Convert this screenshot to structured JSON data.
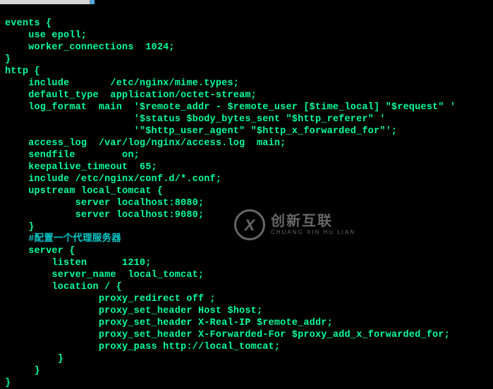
{
  "tab_visible": true,
  "watermark": {
    "icon_letter": "X",
    "line1": "创新互联",
    "line2": "CHUANG XIN HU LIAN"
  },
  "code": {
    "l1": "events {",
    "l2": "    use epoll;",
    "l3": "    worker_connections  1024;",
    "l4": "}",
    "l5": "http {",
    "l6": "    include       /etc/nginx/mime.types;",
    "l7": "    default_type  application/octet-stream;",
    "l8": "    log_format  main  '$remote_addr - $remote_user [$time_local] \"$request\" '",
    "l9": "                      '$status $body_bytes_sent \"$http_referer\" '",
    "l10": "                      '\"$http_user_agent\" \"$http_x_forwarded_for\"';",
    "l11": "    access_log  /var/log/nginx/access.log  main;",
    "l12": "    sendfile        on;",
    "l13": "    keepalive_timeout  65;",
    "l14": "    include /etc/nginx/conf.d/*.conf;",
    "l15": "    upstream local_tomcat {",
    "l16": "            server localhost:8080;",
    "l17": "            server localhost:9080;",
    "l18": "    }",
    "l19": "    #配置一个代理服务器",
    "l20": "    server {",
    "l21": "        listen      1210;",
    "l22": "        server_name  local_tomcat;",
    "l23": "        location / {",
    "l24": "                proxy_redirect off ;",
    "l25": "                proxy_set_header Host $host;",
    "l26": "                proxy_set_header X-Real-IP $remote_addr;",
    "l27": "                proxy_set_header X-Forwarded-For $proxy_add_x_forwarded_for;",
    "l28": "                proxy_pass http://local_tomcat;",
    "l29": "         }",
    "l30": "     }",
    "l31": "}"
  }
}
